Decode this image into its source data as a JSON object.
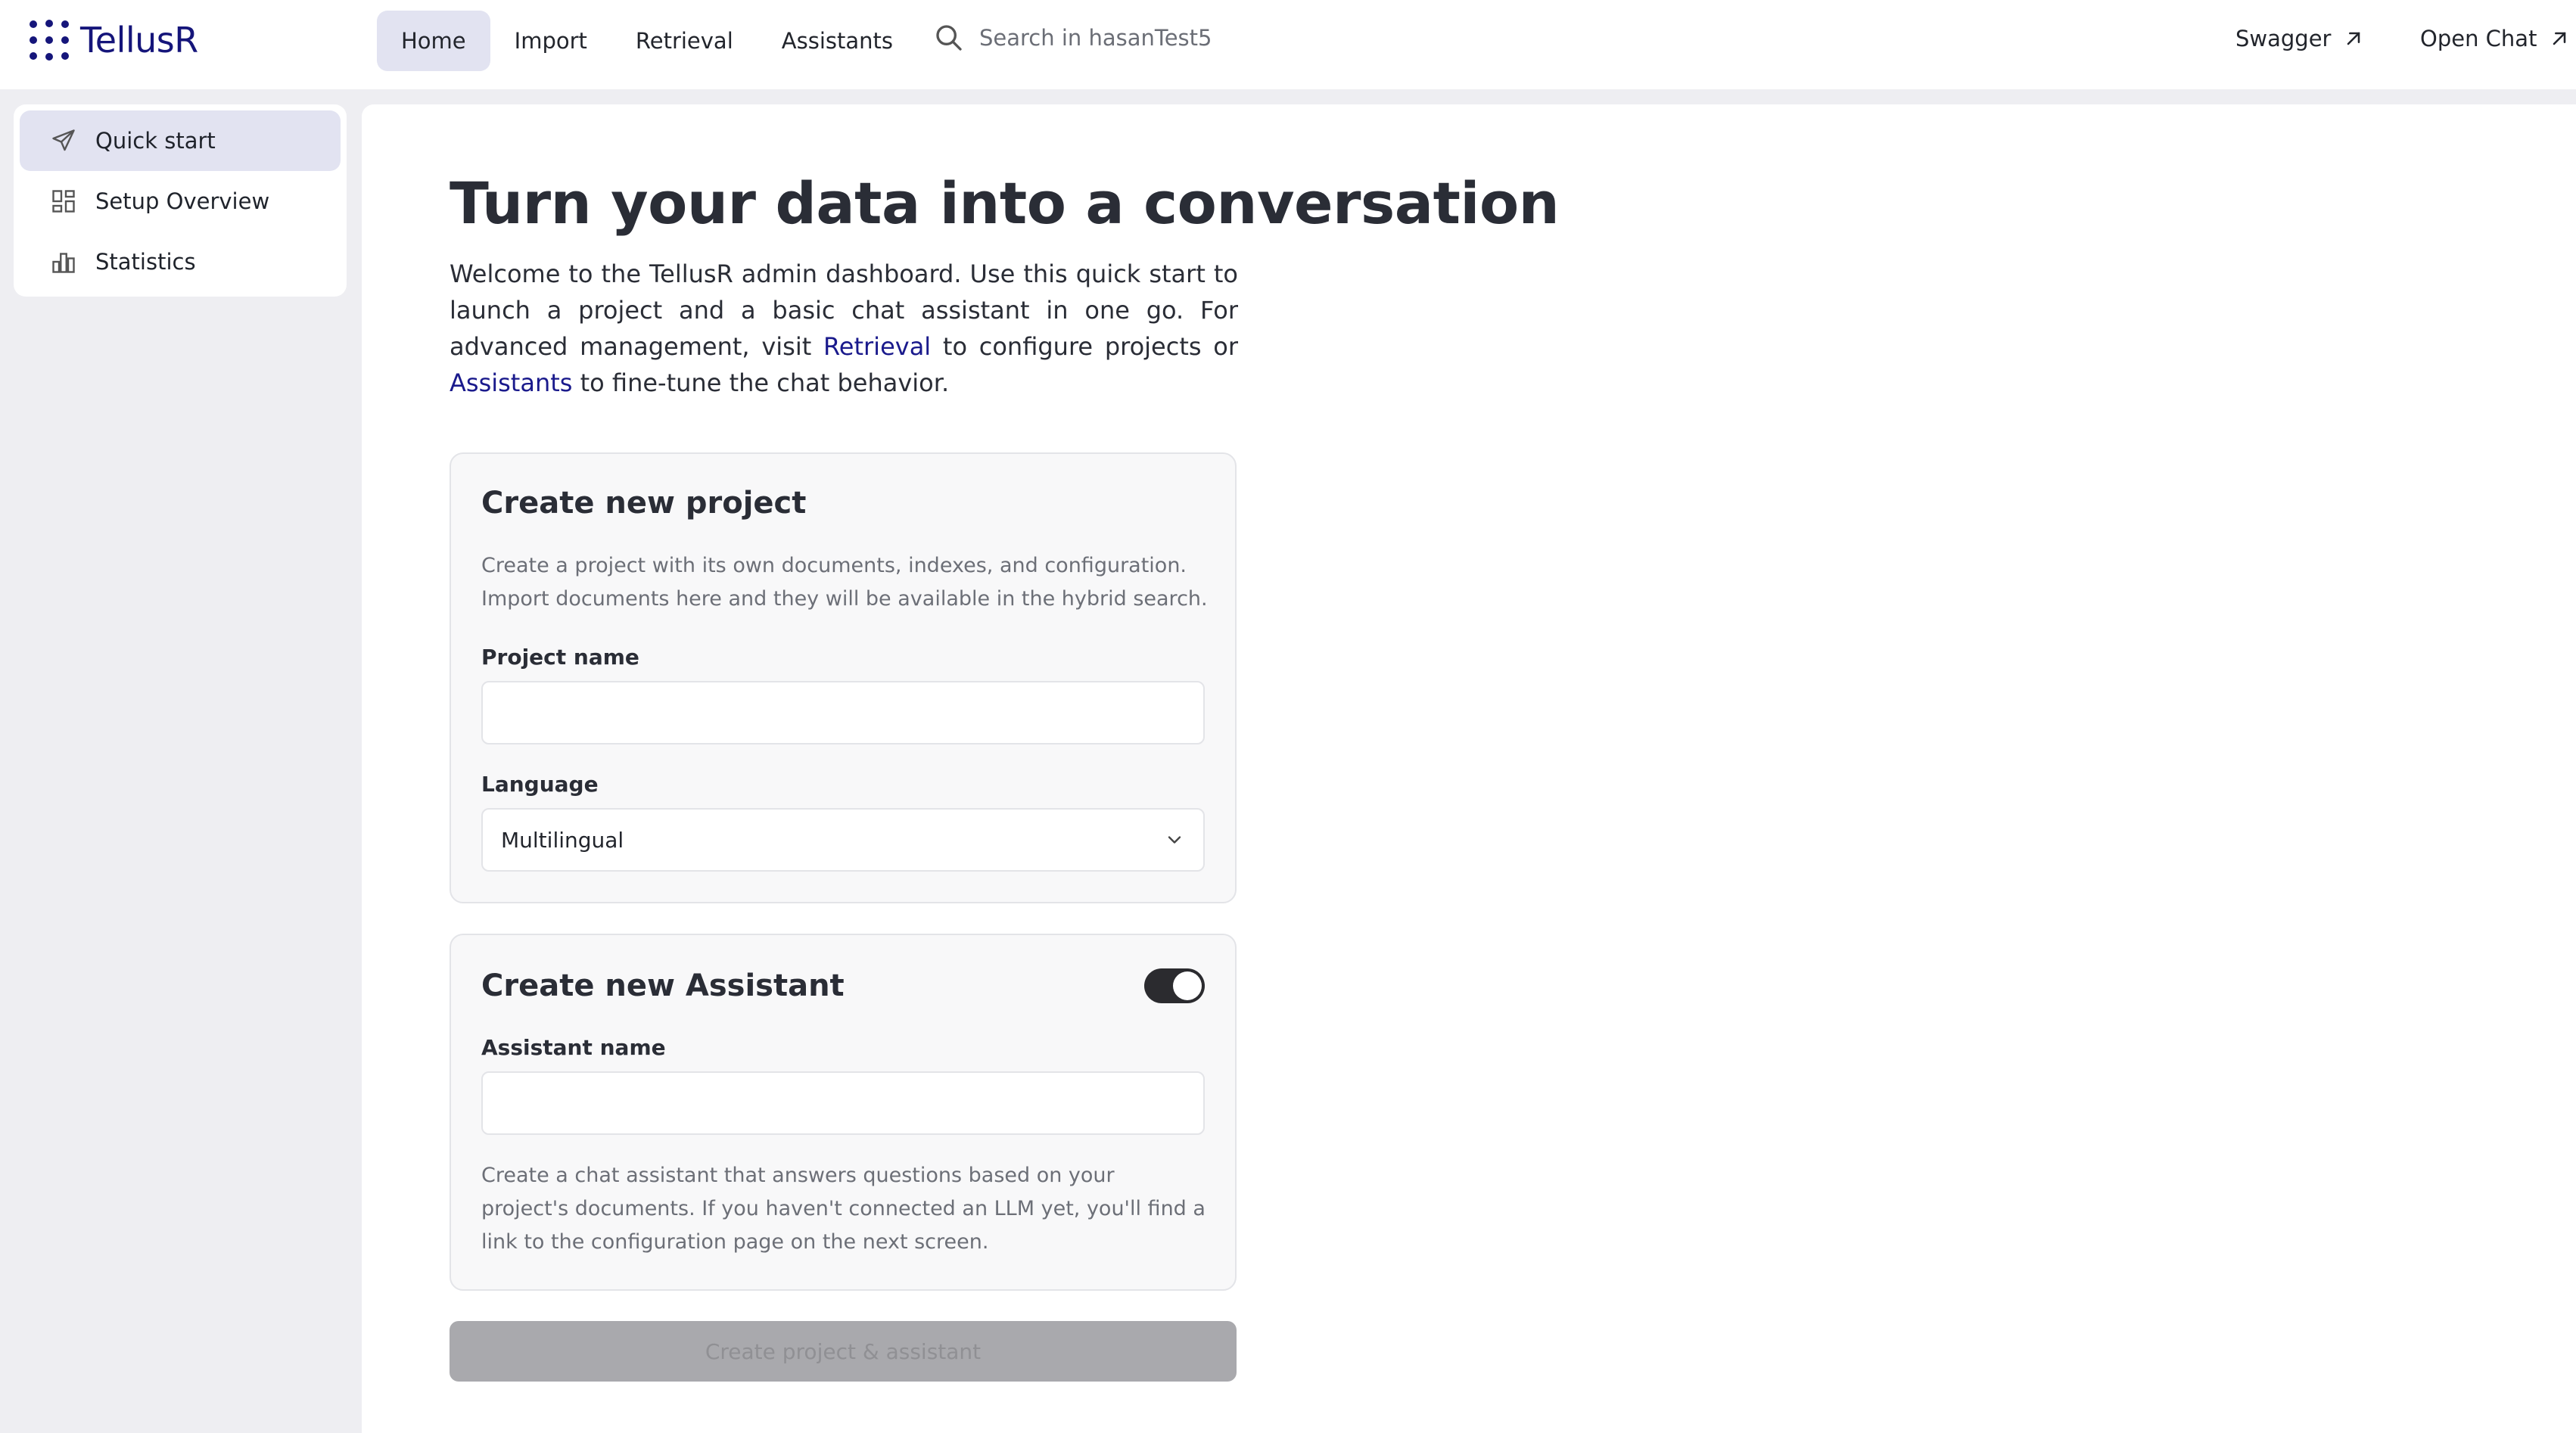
{
  "app": {
    "name": "TellusR"
  },
  "nav": {
    "items": [
      {
        "label": "Home",
        "active": true
      },
      {
        "label": "Import",
        "active": false
      },
      {
        "label": "Retrieval",
        "active": false
      },
      {
        "label": "Assistants",
        "active": false
      }
    ]
  },
  "search": {
    "placeholder": "Search in hasanTest5",
    "icon": "search-icon"
  },
  "external_links": [
    {
      "label": "Swagger",
      "icon": "arrow-up-right-icon"
    },
    {
      "label": "Open Chat",
      "icon": "arrow-up-right-icon"
    }
  ],
  "sidebar": {
    "items": [
      {
        "label": "Quick start",
        "icon": "send-icon",
        "active": true
      },
      {
        "label": "Setup Overview",
        "icon": "dashboard-icon",
        "active": false
      },
      {
        "label": "Statistics",
        "icon": "bar-chart-icon",
        "active": false
      }
    ]
  },
  "main": {
    "title": "Turn your data into a conversation",
    "intro": {
      "part1": "Welcome to the TellusR admin dashboard. Use this quick start to launch a project and a basic chat assistant in one go. For advanced management, visit ",
      "link1": "Retrieval",
      "part2": " to configure projects or ",
      "link2": "Assistants",
      "part3": " to fine-tune the chat behavior."
    },
    "project_card": {
      "title": "Create new project",
      "description": "Create a project with its own documents, indexes, and configuration. Import documents here and they will be available in the hybrid search.",
      "name_label": "Project name",
      "name_value": "",
      "language_label": "Language",
      "language_value": "Multilingual"
    },
    "assistant_card": {
      "title": "Create new Assistant",
      "toggle_on": true,
      "name_label": "Assistant name",
      "name_value": "",
      "description": "Create a chat assistant that answers questions based on your project's documents. If you haven't connected an LLM yet, you'll find a link to the configuration page on the next screen."
    },
    "submit_label": "Create project & assistant"
  },
  "colors": {
    "brand": "#15157a",
    "link": "#1a1a8c",
    "active_bg": "#e2e3f1",
    "disabled_button": "#a9a9ad"
  }
}
